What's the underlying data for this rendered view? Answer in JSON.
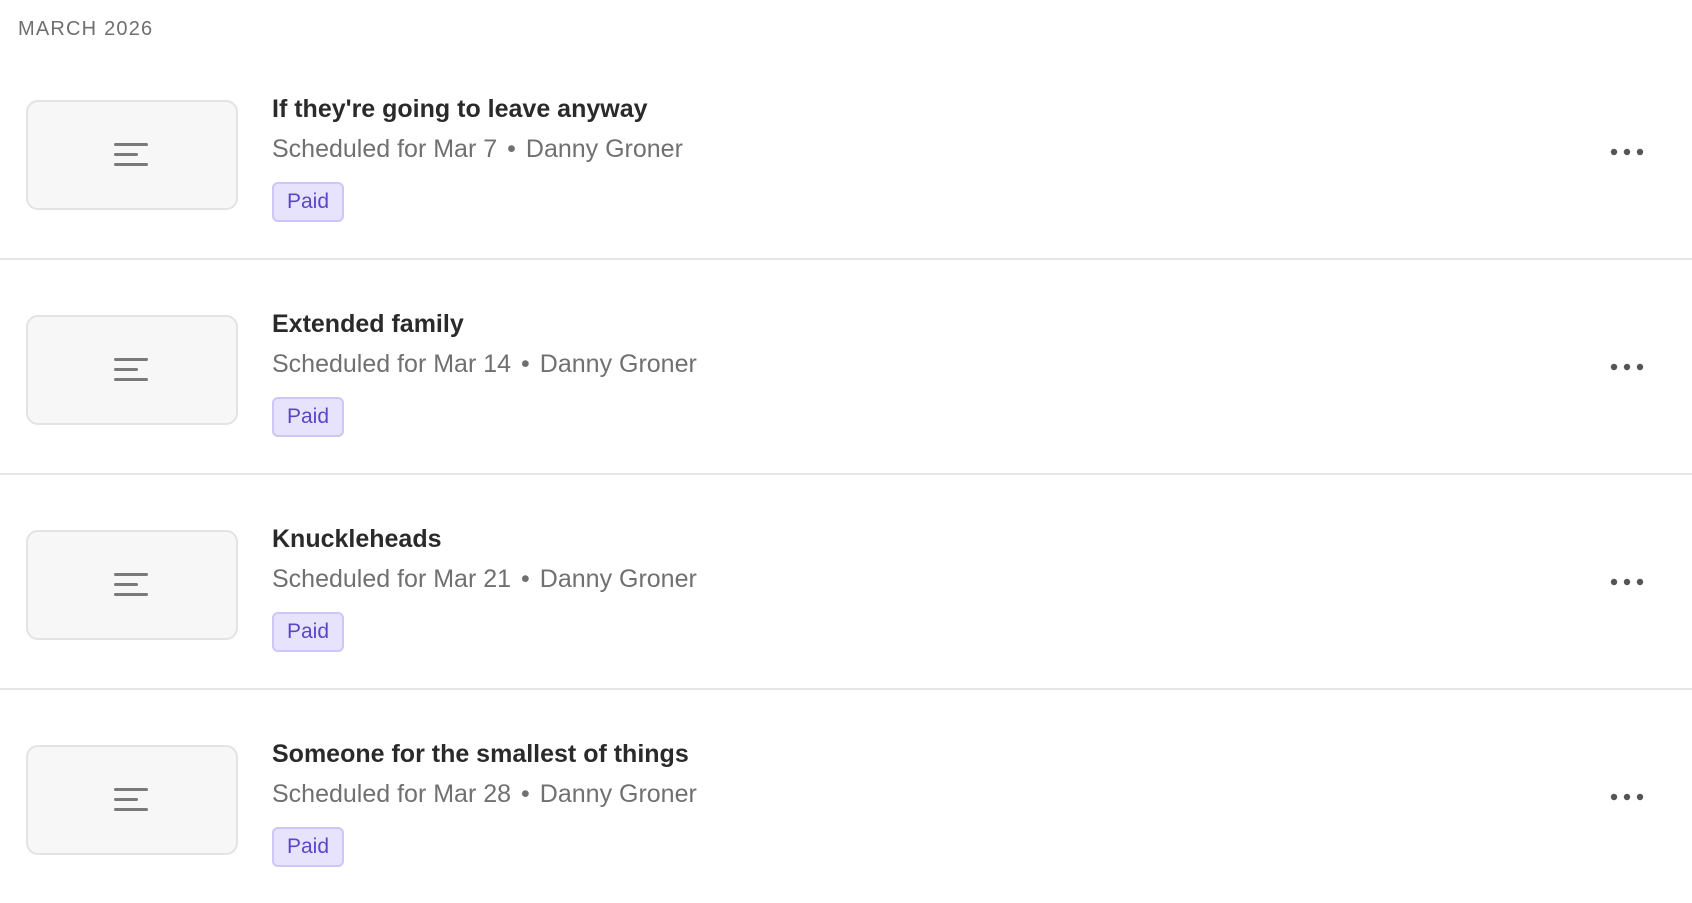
{
  "section": {
    "label": "MARCH 2026"
  },
  "posts": [
    {
      "title": "If they're going to leave anyway",
      "scheduled": "Scheduled for Mar 7",
      "separator": "•",
      "author": "Danny Groner",
      "badge": "Paid",
      "thumbnail_icon": "text-lines-icon",
      "menu_icon": "more-horizontal-icon"
    },
    {
      "title": "Extended family",
      "scheduled": "Scheduled for Mar 14",
      "separator": "•",
      "author": "Danny Groner",
      "badge": "Paid",
      "thumbnail_icon": "text-lines-icon",
      "menu_icon": "more-horizontal-icon"
    },
    {
      "title": "Knuckleheads",
      "scheduled": "Scheduled for Mar 21",
      "separator": "•",
      "author": "Danny Groner",
      "badge": "Paid",
      "thumbnail_icon": "text-lines-icon",
      "menu_icon": "more-horizontal-icon"
    },
    {
      "title": "Someone for the smallest of things",
      "scheduled": "Scheduled for Mar 28",
      "separator": "•",
      "author": "Danny Groner",
      "badge": "Paid",
      "thumbnail_icon": "text-lines-icon",
      "menu_icon": "more-horizontal-icon"
    }
  ],
  "colors": {
    "badge_background": "#e8e3fd",
    "badge_border": "#cfc5f7",
    "badge_text": "#5b45c8",
    "meta_text": "#707070",
    "divider": "#e6e6e6"
  }
}
